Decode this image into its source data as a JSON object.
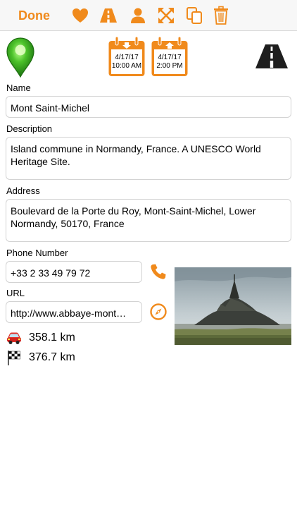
{
  "toolbar": {
    "done_label": "Done",
    "accent_color": "#f08a1c",
    "icons": [
      "heart-icon",
      "road-icon",
      "person-icon",
      "expand-icon",
      "copy-icon",
      "trash-icon"
    ]
  },
  "header": {
    "pin_icon": "green-map-pin-icon",
    "arrival": {
      "date": "4/17/17",
      "time": "10:00 AM",
      "icon": "calendar-arrival-icon"
    },
    "departure": {
      "date": "4/17/17",
      "time": "2:00 PM",
      "icon": "calendar-departure-icon"
    },
    "route_icon": "road-icon"
  },
  "form": {
    "name_label": "Name",
    "name_value": "Mont Saint-Michel",
    "description_label": "Description",
    "description_value": "Island commune in Normandy, France. A UNESCO World Heritage Site.",
    "address_label": "Address",
    "address_value": "Boulevard de la Porte du Roy, Mont-Saint-Michel, Lower Normandy, 50170, France",
    "phone_label": "Phone Number",
    "phone_value": "+33 2 33 49 79 72",
    "url_label": "URL",
    "url_value": "http://www.abbaye-mont…"
  },
  "distances": {
    "car_icon": "car-icon",
    "car_distance": "358.1 km",
    "flag_icon": "checkered-flag-icon",
    "flag_distance": "376.7 km"
  },
  "photo": {
    "subject": "Mont Saint-Michel abbey photo"
  }
}
